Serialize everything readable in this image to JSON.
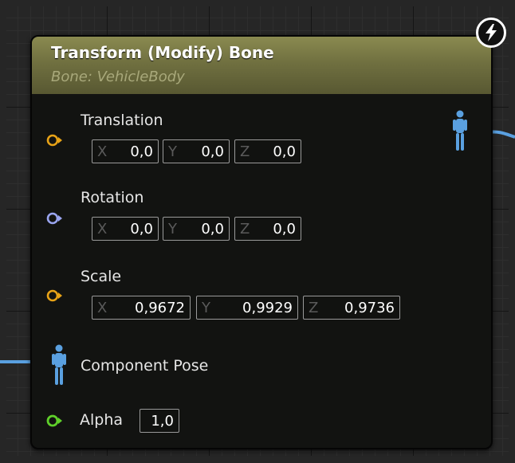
{
  "node": {
    "title": "Transform (Modify) Bone",
    "subtitle": "Bone: VehicleBody",
    "accent_header": "#707040",
    "badge_icon": "lightning-bolt-icon"
  },
  "pins": {
    "translation": {
      "label": "Translation",
      "pin_color": "#e8a317",
      "x_axis": "X",
      "x": "0,0",
      "y_axis": "Y",
      "y": "0,0",
      "z_axis": "Z",
      "z": "0,0"
    },
    "rotation": {
      "label": "Rotation",
      "pin_color": "#9aa5f0",
      "x_axis": "X",
      "x": "0,0",
      "y_axis": "Y",
      "y": "0,0",
      "z_axis": "Z",
      "z": "0,0"
    },
    "scale": {
      "label": "Scale",
      "pin_color": "#e8a317",
      "x_axis": "X",
      "x": "0,9672",
      "y_axis": "Y",
      "y": "0,9929",
      "z_axis": "Z",
      "z": "0,9736"
    },
    "component_pose": {
      "label": "Component Pose",
      "pin_color": "#5aa0e0",
      "icon": "pose-figure-icon"
    },
    "alpha": {
      "label": "Alpha",
      "pin_color": "#5fd02a",
      "value": "1,0"
    },
    "output_pose": {
      "pin_color": "#5aa0e0",
      "icon": "pose-figure-icon"
    }
  }
}
